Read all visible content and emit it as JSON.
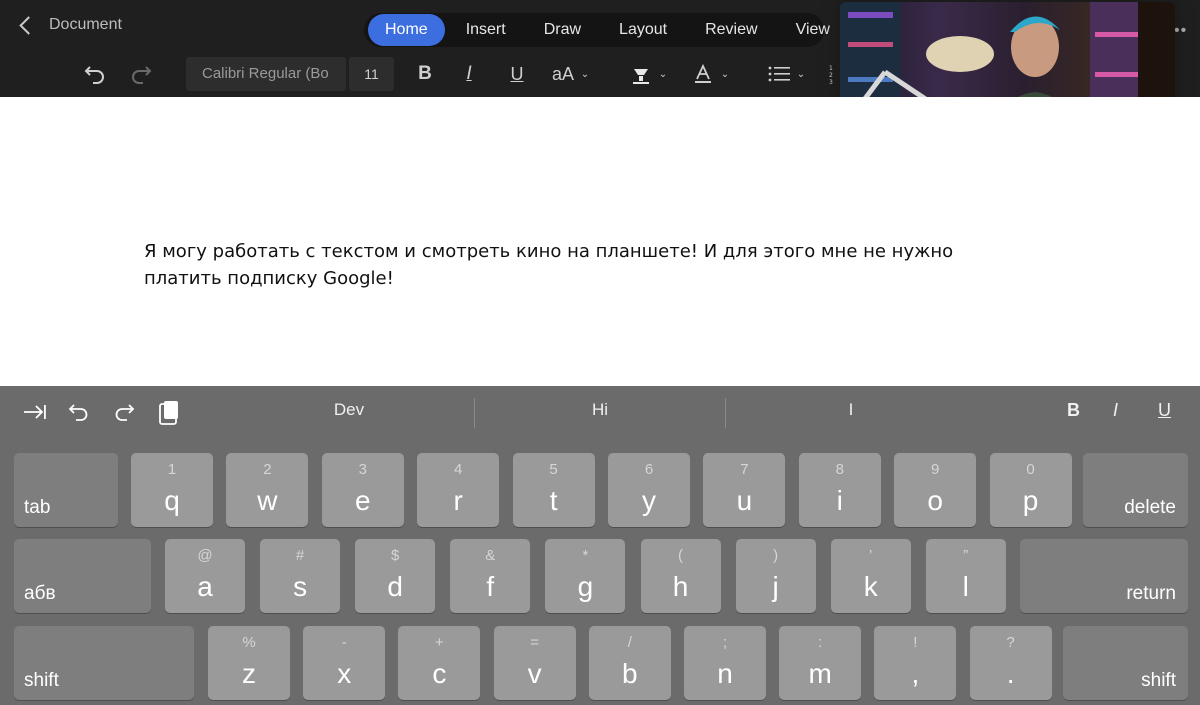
{
  "header": {
    "back_label": "Document",
    "tabs": [
      "Home",
      "Insert",
      "Draw",
      "Layout",
      "Review",
      "View"
    ],
    "active_tab": "Home",
    "font_name": "Calibri Regular (Bo",
    "font_size": "11",
    "bold": "B",
    "italic": "I",
    "underline": "U",
    "text_size": "aA",
    "more": "••"
  },
  "document": {
    "text": "Я могу работать с текстом и смотреть кино на планшете! И для этого мне не нужно платить подписку Google!"
  },
  "keyboard": {
    "suggestions": [
      "Dev",
      "Hi",
      "I"
    ],
    "format": {
      "bold": "B",
      "italic": "I",
      "underline": "U"
    },
    "row1": [
      {
        "alt": "1",
        "main": "q"
      },
      {
        "alt": "2",
        "main": "w"
      },
      {
        "alt": "3",
        "main": "e"
      },
      {
        "alt": "4",
        "main": "r"
      },
      {
        "alt": "5",
        "main": "t"
      },
      {
        "alt": "6",
        "main": "y"
      },
      {
        "alt": "7",
        "main": "u"
      },
      {
        "alt": "8",
        "main": "i"
      },
      {
        "alt": "9",
        "main": "o"
      },
      {
        "alt": "0",
        "main": "p"
      }
    ],
    "row2": [
      {
        "alt": "@",
        "main": "a"
      },
      {
        "alt": "#",
        "main": "s"
      },
      {
        "alt": "$",
        "main": "d"
      },
      {
        "alt": "&",
        "main": "f"
      },
      {
        "alt": "*",
        "main": "g"
      },
      {
        "alt": "(",
        "main": "h"
      },
      {
        "alt": ")",
        "main": "j"
      },
      {
        "alt": "’",
        "main": "k"
      },
      {
        "alt": "”",
        "main": "l"
      }
    ],
    "row3": [
      {
        "alt": "%",
        "main": "z"
      },
      {
        "alt": "-",
        "main": "x"
      },
      {
        "alt": "+",
        "main": "c"
      },
      {
        "alt": "=",
        "main": "v"
      },
      {
        "alt": "/",
        "main": "b"
      },
      {
        "alt": ";",
        "main": "n"
      },
      {
        "alt": ":",
        "main": "m"
      },
      {
        "alt": "!",
        "main": ","
      },
      {
        "alt": "?",
        "main": "."
      }
    ],
    "tab_label": "tab",
    "delete_label": "delete",
    "lang_label": "абв",
    "return_label": "return",
    "shift_label": "shift"
  },
  "colors": {
    "accent": "#3c6ee0",
    "toolbar_bg": "#1f1f1f",
    "keyboard_bg": "#6b6b6b",
    "key_bg": "#9a9a9a"
  },
  "icons": [
    "undo-icon",
    "redo-icon",
    "paint-bucket-icon",
    "font-color-icon",
    "list-icon",
    "numbered-list-icon",
    "tab-icon",
    "clipboard-icon"
  ]
}
